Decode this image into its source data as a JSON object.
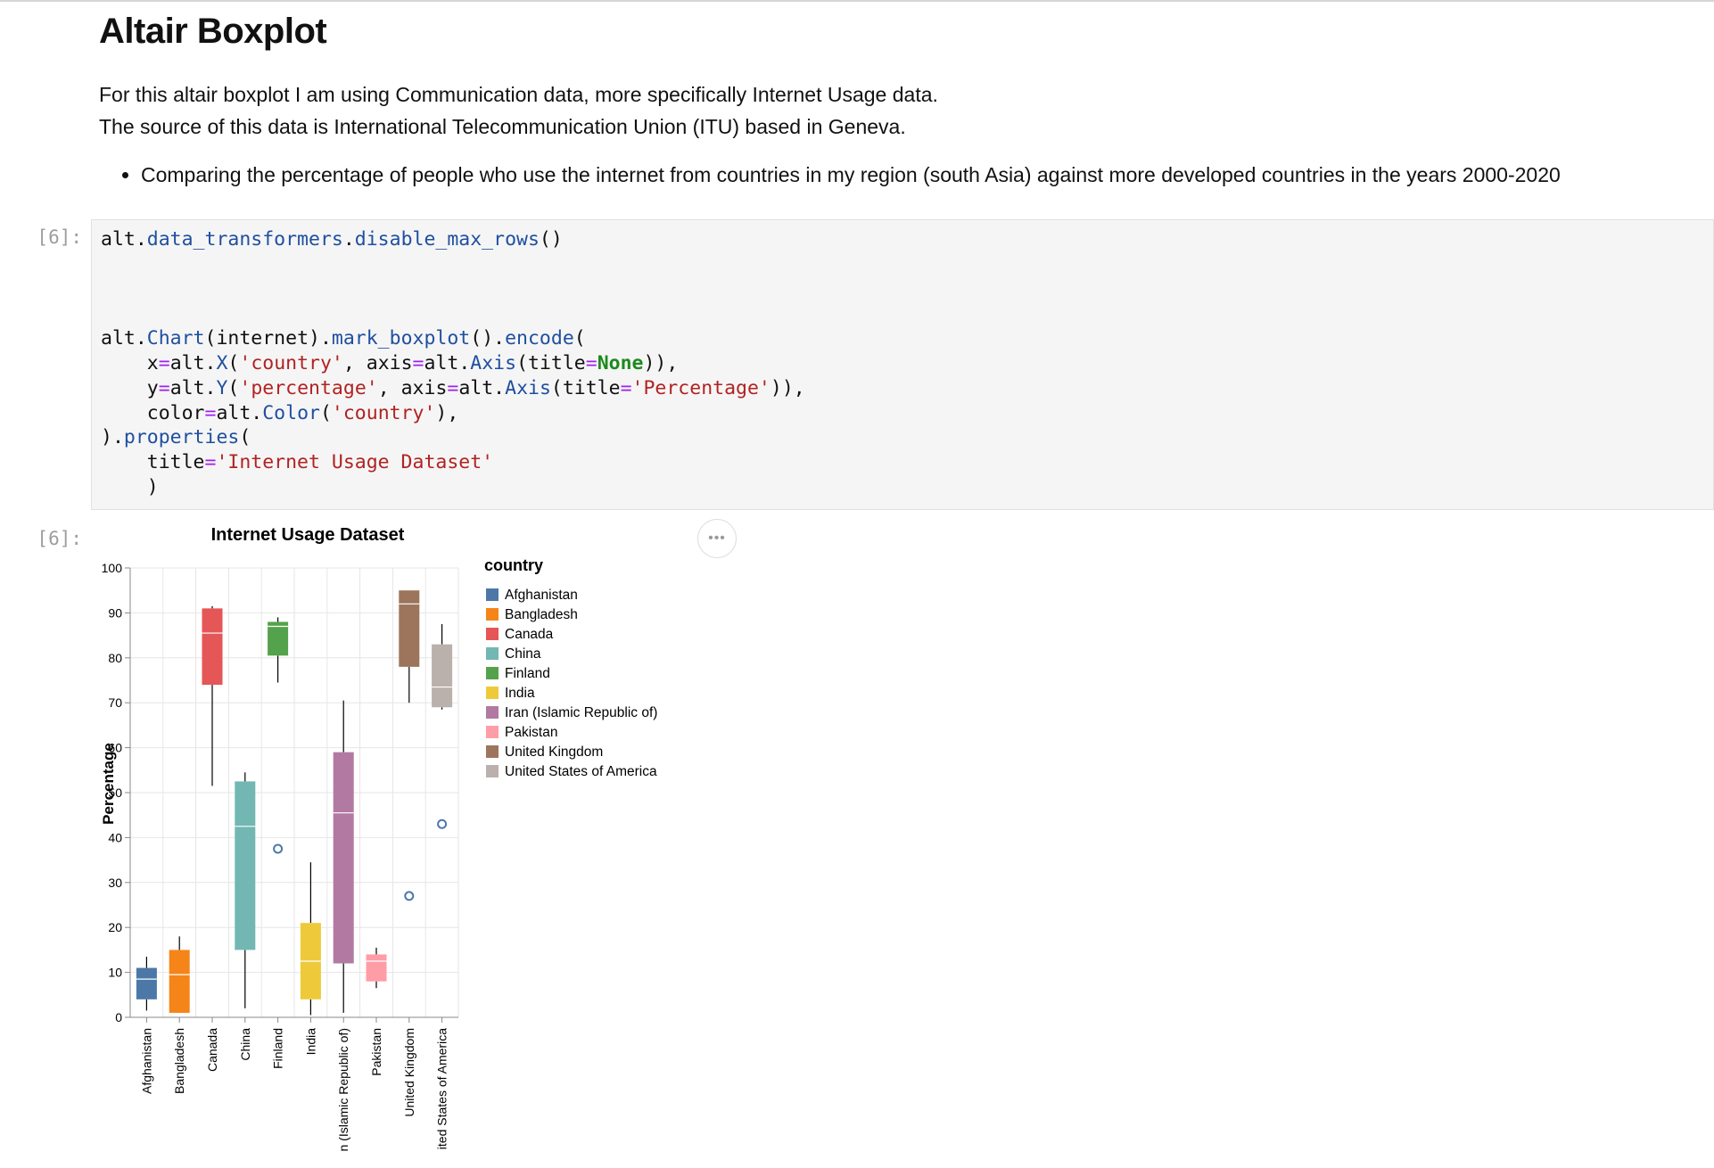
{
  "markdown": {
    "heading": "Altair Boxplot",
    "paragraph_line1": "For this altair boxplot I am using Communication data, more specifically Internet Usage data.",
    "paragraph_line2": "The source of this data is International Telecommunication Union (ITU) based in Geneva.",
    "bullet": "Comparing the percentage of people who use the internet from countries in my region (south Asia) against more developed countries in the years 2000-2020"
  },
  "input_prompt": "[6]:",
  "output_prompt": "[6]:",
  "more_button": "•••",
  "code_lines": [
    [
      {
        "t": "alt.",
        "c": ""
      },
      {
        "t": "data_transformers",
        "c": "f"
      },
      {
        "t": ".",
        "c": ""
      },
      {
        "t": "disable_max_rows",
        "c": "f"
      },
      {
        "t": "()",
        "c": ""
      }
    ],
    [],
    [],
    [],
    [
      {
        "t": "alt.",
        "c": ""
      },
      {
        "t": "Chart",
        "c": "f"
      },
      {
        "t": "(internet).",
        "c": ""
      },
      {
        "t": "mark_boxplot",
        "c": "f"
      },
      {
        "t": "().",
        "c": ""
      },
      {
        "t": "encode",
        "c": "f"
      },
      {
        "t": "(",
        "c": ""
      }
    ],
    [
      {
        "t": "    x",
        "c": ""
      },
      {
        "t": "=",
        "c": "o"
      },
      {
        "t": "alt.",
        "c": ""
      },
      {
        "t": "X",
        "c": "f"
      },
      {
        "t": "(",
        "c": ""
      },
      {
        "t": "'country'",
        "c": "s"
      },
      {
        "t": ", axis",
        "c": ""
      },
      {
        "t": "=",
        "c": "o"
      },
      {
        "t": "alt.",
        "c": ""
      },
      {
        "t": "Axis",
        "c": "f"
      },
      {
        "t": "(title",
        "c": ""
      },
      {
        "t": "=",
        "c": "o"
      },
      {
        "t": "None",
        "c": "k"
      },
      {
        "t": ")),",
        "c": ""
      }
    ],
    [
      {
        "t": "    y",
        "c": ""
      },
      {
        "t": "=",
        "c": "o"
      },
      {
        "t": "alt.",
        "c": ""
      },
      {
        "t": "Y",
        "c": "f"
      },
      {
        "t": "(",
        "c": ""
      },
      {
        "t": "'percentage'",
        "c": "s"
      },
      {
        "t": ", axis",
        "c": ""
      },
      {
        "t": "=",
        "c": "o"
      },
      {
        "t": "alt.",
        "c": ""
      },
      {
        "t": "Axis",
        "c": "f"
      },
      {
        "t": "(title",
        "c": ""
      },
      {
        "t": "=",
        "c": "o"
      },
      {
        "t": "'Percentage'",
        "c": "s"
      },
      {
        "t": ")),",
        "c": ""
      }
    ],
    [
      {
        "t": "    color",
        "c": ""
      },
      {
        "t": "=",
        "c": "o"
      },
      {
        "t": "alt.",
        "c": ""
      },
      {
        "t": "Color",
        "c": "f"
      },
      {
        "t": "(",
        "c": ""
      },
      {
        "t": "'country'",
        "c": "s"
      },
      {
        "t": "),",
        "c": ""
      }
    ],
    [
      {
        "t": ").",
        "c": ""
      },
      {
        "t": "properties",
        "c": "f"
      },
      {
        "t": "(",
        "c": ""
      }
    ],
    [
      {
        "t": "    title",
        "c": ""
      },
      {
        "t": "=",
        "c": "o"
      },
      {
        "t": "'Internet Usage Dataset'",
        "c": "s"
      }
    ],
    [
      {
        "t": "    )",
        "c": ""
      }
    ]
  ],
  "chart_data": {
    "type": "boxplot",
    "title": "Internet Usage Dataset",
    "ylabel": "Percentage",
    "xlabel": "",
    "ylim": [
      0,
      100
    ],
    "yticks": [
      0,
      10,
      20,
      30,
      40,
      50,
      60,
      70,
      80,
      90,
      100
    ],
    "grid": true,
    "legend_title": "country",
    "legend_position": "right",
    "categories": [
      "Afghanistan",
      "Bangladesh",
      "Canada",
      "China",
      "Finland",
      "India",
      "Iran (Islamic Republic of)",
      "Pakistan",
      "United Kingdom",
      "United States of America"
    ],
    "x_tick_labels": [
      "Afghanistan",
      "Bangladesh",
      "Canada",
      "China",
      "Finland",
      "India",
      "n (Islamic Republic of)",
      "Pakistan",
      "United Kingdom",
      "ited States of America"
    ],
    "colors": [
      "#4c78a8",
      "#f58518",
      "#e45756",
      "#72b7b2",
      "#54a24b",
      "#eeca3b",
      "#b279a2",
      "#ff9da6",
      "#9d755d",
      "#bab0ac"
    ],
    "boxes": [
      {
        "country": "Afghanistan",
        "min": 1.5,
        "q1": 4,
        "median": 8.5,
        "q3": 11,
        "max": 13.5,
        "outliers": []
      },
      {
        "country": "Bangladesh",
        "min": 1,
        "q1": 1,
        "median": 9.5,
        "q3": 15,
        "max": 18,
        "outliers": []
      },
      {
        "country": "Canada",
        "min": 51.5,
        "q1": 74,
        "median": 85.5,
        "q3": 91,
        "max": 91.5,
        "outliers": []
      },
      {
        "country": "China",
        "min": 2,
        "q1": 15,
        "median": 42.5,
        "q3": 52.5,
        "max": 54.5,
        "outliers": []
      },
      {
        "country": "Finland",
        "min": 74.5,
        "q1": 80.5,
        "median": 87,
        "q3": 88,
        "max": 89,
        "outliers": [
          37.5
        ]
      },
      {
        "country": "India",
        "min": 0.5,
        "q1": 4,
        "median": 12.5,
        "q3": 21,
        "max": 34.5,
        "outliers": []
      },
      {
        "country": "Iran (Islamic Republic of)",
        "min": 1,
        "q1": 12,
        "median": 45.5,
        "q3": 59,
        "max": 70.5,
        "outliers": []
      },
      {
        "country": "Pakistan",
        "min": 6.5,
        "q1": 8,
        "median": 12.5,
        "q3": 14,
        "max": 15.5,
        "outliers": []
      },
      {
        "country": "United Kingdom",
        "min": 70,
        "q1": 78,
        "median": 92,
        "q3": 95,
        "max": 95,
        "outliers": [
          27
        ]
      },
      {
        "country": "United States of America",
        "min": 68.5,
        "q1": 69,
        "median": 73.5,
        "q3": 83,
        "max": 87.5,
        "outliers": [
          43
        ]
      }
    ]
  }
}
